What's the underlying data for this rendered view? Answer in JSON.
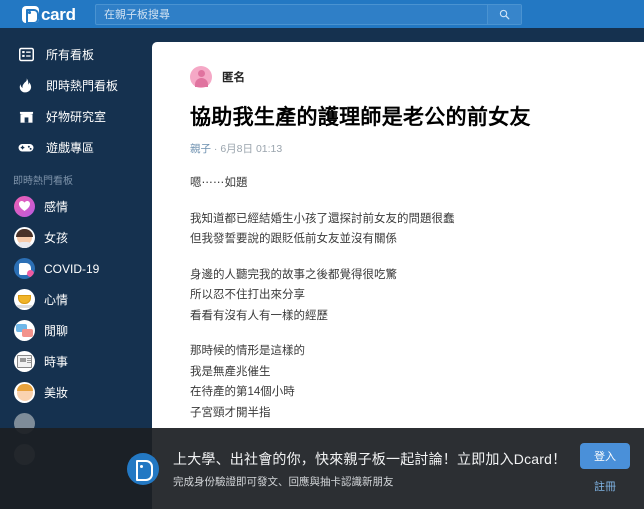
{
  "header": {
    "logo_text": "card",
    "logo_icon": "dcard-logo-icon",
    "search_placeholder": "在親子板搜尋",
    "search_value": "",
    "search_icon": "search-icon",
    "accent_color": "#2378c3"
  },
  "sidebar": {
    "background_color": "#15314f",
    "nav": [
      {
        "label": "所有看板",
        "icon": "list-grid-icon"
      },
      {
        "label": "即時熱門看板",
        "icon": "fire-icon"
      },
      {
        "label": "好物研究室",
        "icon": "shop-icon"
      },
      {
        "label": "遊戲專區",
        "icon": "gamepad-icon"
      }
    ],
    "section_title": "即時熱門看板",
    "boards": [
      {
        "label": "感情",
        "icon": "heart-avatar"
      },
      {
        "label": "女孩",
        "icon": "girl-avatar"
      },
      {
        "label": "COVID-19",
        "icon": "covid-avatar"
      },
      {
        "label": "心情",
        "icon": "coffee-cup-avatar"
      },
      {
        "label": "閒聊",
        "icon": "chat-bubbles-avatar"
      },
      {
        "label": "時事",
        "icon": "newspaper-avatar"
      },
      {
        "label": "美妝",
        "icon": "beauty-face-avatar"
      },
      {
        "label": "",
        "icon": "board-avatar"
      },
      {
        "label": "",
        "icon": "board-avatar"
      }
    ]
  },
  "post": {
    "author": "匿名",
    "author_avatar": "anonymous-avatar",
    "title": "協助我生產的護理師是老公的前女友",
    "board": "親子",
    "separator": "·",
    "timestamp": "6月8日 01:13",
    "paragraphs": [
      "嗯⋯⋯如題",
      "我知道都已經結婚生小孩了還探討前女友的問題很蠢\n但我發誓要說的跟貶低前女友並沒有關係",
      "身邊的人聽完我的故事之後都覺得很吃驚\n所以忍不住打出來分享\n看看有沒有人有一樣的經歷",
      "那時候的情形是這樣的\n我是無產兆催生\n在待產的第14個小時\n子宮頸才開半指"
    ]
  },
  "banner": {
    "icon": "dcard-logo-icon",
    "title": "上大學、出社會的你，快來親子板一起討論！立即加入Dcard！",
    "subtitle": "完成身份驗證即可發文、回應與抽卡認識新朋友",
    "login_label": "登入",
    "signup_label": "註冊",
    "login_color": "#4a90d9"
  }
}
